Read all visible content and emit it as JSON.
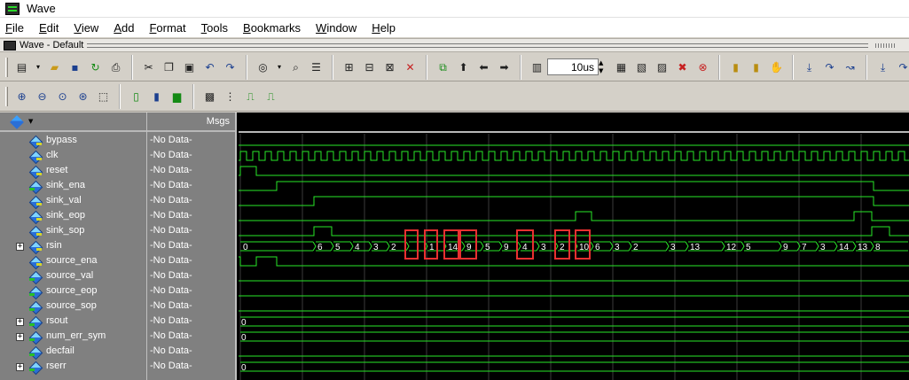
{
  "window": {
    "title": "Wave",
    "subwindow_title": "Wave - Default"
  },
  "menu": [
    "File",
    "Edit",
    "View",
    "Add",
    "Format",
    "Tools",
    "Bookmarks",
    "Window",
    "Help"
  ],
  "toolbar": {
    "time_value": "10us"
  },
  "msgs_header": "Msgs",
  "signals": [
    {
      "name": "bypass",
      "value": "-No Data-",
      "expandable": false,
      "dir": "in"
    },
    {
      "name": "clk",
      "value": "-No Data-",
      "expandable": false,
      "dir": "in"
    },
    {
      "name": "reset",
      "value": "-No Data-",
      "expandable": false,
      "dir": "in"
    },
    {
      "name": "sink_ena",
      "value": "-No Data-",
      "expandable": false,
      "dir": "out"
    },
    {
      "name": "sink_val",
      "value": "-No Data-",
      "expandable": false,
      "dir": "in"
    },
    {
      "name": "sink_eop",
      "value": "-No Data-",
      "expandable": false,
      "dir": "in"
    },
    {
      "name": "sink_sop",
      "value": "-No Data-",
      "expandable": false,
      "dir": "in"
    },
    {
      "name": "rsin",
      "value": "-No Data-",
      "expandable": true,
      "dir": "in"
    },
    {
      "name": "source_ena",
      "value": "-No Data-",
      "expandable": false,
      "dir": "in"
    },
    {
      "name": "source_val",
      "value": "-No Data-",
      "expandable": false,
      "dir": "out"
    },
    {
      "name": "source_eop",
      "value": "-No Data-",
      "expandable": false,
      "dir": "out"
    },
    {
      "name": "source_sop",
      "value": "-No Data-",
      "expandable": false,
      "dir": "out"
    },
    {
      "name": "rsout",
      "value": "-No Data-",
      "expandable": true,
      "dir": "out"
    },
    {
      "name": "num_err_sym",
      "value": "-No Data-",
      "expandable": true,
      "dir": "out"
    },
    {
      "name": "decfail",
      "value": "-No Data-",
      "expandable": false,
      "dir": "out"
    },
    {
      "name": "rserr",
      "value": "-No Data-",
      "expandable": true,
      "dir": "out"
    }
  ],
  "rsin_labels": [
    "0",
    "6",
    "5",
    "4",
    "3",
    "2",
    "1",
    "14",
    "9",
    "5",
    "9",
    "4",
    "3",
    "2",
    "10",
    "6",
    "3",
    "2",
    "3",
    "13",
    "12",
    "5",
    "9",
    "7",
    "3",
    "14",
    "13",
    "8"
  ],
  "bus_start_labels": {
    "rsout": "0",
    "num_err_sym": "0",
    "rserr": "0"
  },
  "colors": {
    "wave": "#28e828",
    "background": "#000000",
    "grid": "#3a3a3a",
    "highlight": "#e83030",
    "pane": "#808080"
  }
}
